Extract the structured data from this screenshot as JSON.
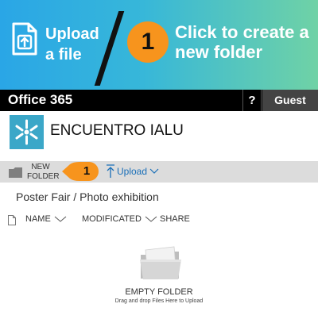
{
  "banner": {
    "upload_label": "Upload a file",
    "step_number": "1",
    "cta": "Click to create a new folder",
    "gradient_start": "#2aa6e6",
    "gradient_end": "#6fd2a6",
    "badge_color": "#f7941d"
  },
  "office_bar": {
    "title": "Office 365",
    "help": "?",
    "user": "Guest"
  },
  "site": {
    "title": "ENCUENTRO IALU",
    "logo_color": "#3ba7c8"
  },
  "toolbar": {
    "new_folder": "NEW FOLDER",
    "callout_number": "1",
    "upload": "Upload"
  },
  "breadcrumb": "Poster Fair / Photo exhibition",
  "columns": {
    "name": "NAME",
    "modified": "MODIFICATED",
    "share": "SHARE"
  },
  "empty_state": {
    "title": "EMPTY FOLDER",
    "subtitle": "Drag and drop Files Here to Upload"
  },
  "icons": [
    "upload-file-icon",
    "folder-icon",
    "upload-arrow-icon",
    "chevron-down-icon",
    "file-icon",
    "empty-folder-icon",
    "site-logo"
  ]
}
